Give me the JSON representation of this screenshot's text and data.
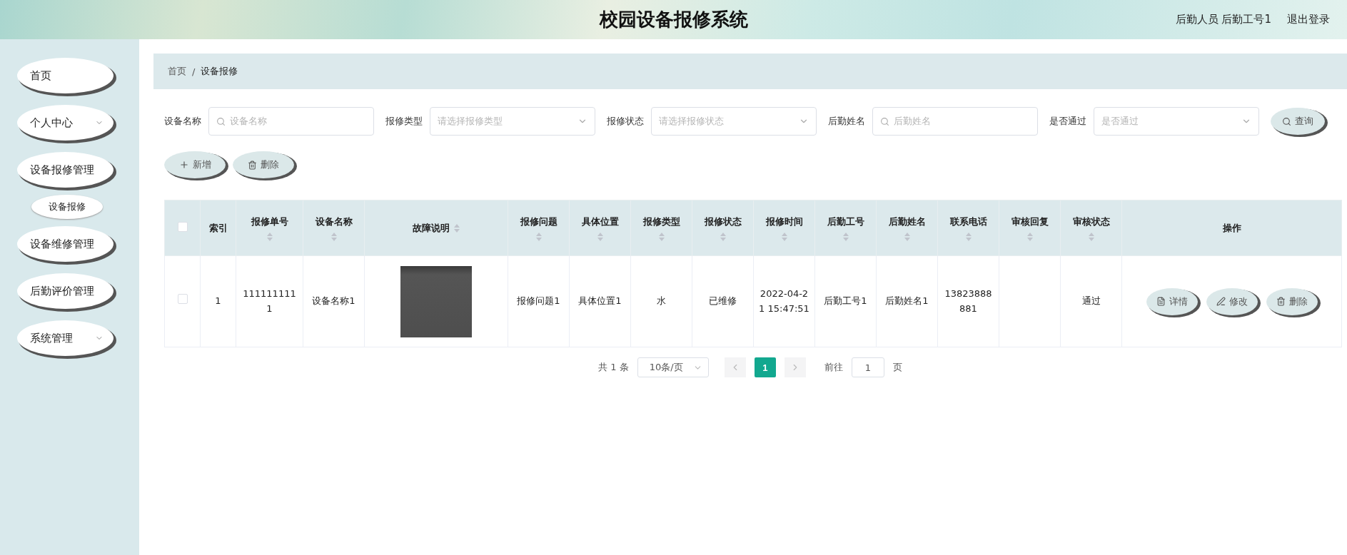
{
  "header": {
    "title": "校园设备报修系统",
    "user": "后勤人员 后勤工号1",
    "logout": "退出登录"
  },
  "sidebar": {
    "items": [
      {
        "label": "首页",
        "kind": "link"
      },
      {
        "label": "个人中心",
        "kind": "submenu"
      },
      {
        "label": "设备报修管理",
        "kind": "link",
        "children": [
          {
            "label": "设备报修"
          }
        ]
      },
      {
        "label": "设备维修管理",
        "kind": "link"
      },
      {
        "label": "后勤评价管理",
        "kind": "link"
      },
      {
        "label": "系统管理",
        "kind": "submenu"
      }
    ]
  },
  "breadcrumb": [
    "首页",
    "/",
    "设备报修"
  ],
  "filters": [
    {
      "label": "设备名称",
      "kind": "input",
      "placeholder": "设备名称"
    },
    {
      "label": "报修类型",
      "kind": "select",
      "placeholder": "请选择报修类型"
    },
    {
      "label": "报修状态",
      "kind": "select",
      "placeholder": "请选择报修状态"
    },
    {
      "label": "后勤姓名",
      "kind": "input",
      "placeholder": "后勤姓名"
    },
    {
      "label": "是否通过",
      "kind": "select",
      "placeholder": "是否通过"
    }
  ],
  "search_button": "查询",
  "actions": [
    {
      "label": "新增",
      "kind": "add"
    },
    {
      "label": "删除",
      "kind": "delete"
    }
  ],
  "table": {
    "select_all_checked": false,
    "columns": [
      {
        "label": "索引",
        "sortable": false
      },
      {
        "label": "报修单号",
        "sortable": true
      },
      {
        "label": "设备名称",
        "sortable": true
      },
      {
        "label": "故障说明",
        "sortable": true
      },
      {
        "label": "报修问题",
        "sortable": true
      },
      {
        "label": "具体位置",
        "sortable": true
      },
      {
        "label": "报修类型",
        "sortable": true
      },
      {
        "label": "报修状态",
        "sortable": true
      },
      {
        "label": "报修时间",
        "sortable": true
      },
      {
        "label": "后勤工号",
        "sortable": true
      },
      {
        "label": "后勤姓名",
        "sortable": true
      },
      {
        "label": "联系电话",
        "sortable": true
      },
      {
        "label": "审核回复",
        "sortable": true
      },
      {
        "label": "审核状态",
        "sortable": true
      },
      {
        "label": "操作",
        "sortable": false
      }
    ],
    "rows": [
      {
        "checked": false,
        "cells": [
          "1",
          "1111111111",
          "设备名称1",
          "",
          "报修问题1",
          "具体位置1",
          "水",
          "已维修",
          "2022-04-21 15:47:51",
          "后勤工号1",
          "后勤姓名1",
          "13823888881",
          "",
          "通过"
        ],
        "buttons": [
          {
            "label": "详情",
            "kind": "detail"
          },
          {
            "label": "修改",
            "kind": "edit"
          },
          {
            "label": "删除",
            "kind": "delete"
          }
        ]
      }
    ]
  },
  "pagination": {
    "total": "共 1 条",
    "page_size": "10条/页",
    "pages": [
      {
        "label": "1",
        "selected": true
      }
    ],
    "goto_label": "前往",
    "goto_value": "1",
    "goto_suffix": "页"
  }
}
